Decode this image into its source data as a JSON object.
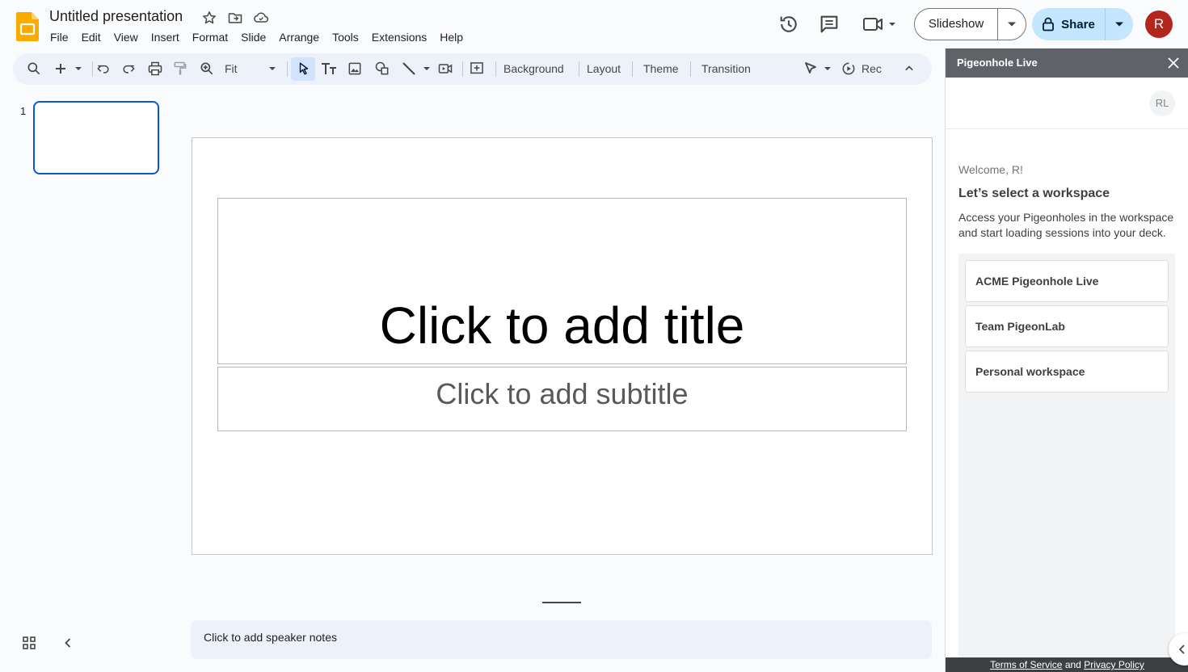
{
  "app": {
    "doc_title": "Untitled presentation",
    "logo_icon": "slides-logo-icon",
    "accent": "#0b57d0",
    "logo_color": "#f9ab00"
  },
  "menu": [
    "File",
    "Edit",
    "View",
    "Insert",
    "Format",
    "Slide",
    "Arrange",
    "Tools",
    "Extensions",
    "Help"
  ],
  "header": {
    "slideshow_label": "Slideshow",
    "share_label": "Share",
    "avatar_initial": "R",
    "avatar_color": "#b3261e"
  },
  "toolbar": {
    "zoom_label": "Fit",
    "background_label": "Background",
    "layout_label": "Layout",
    "theme_label": "Theme",
    "transition_label": "Transition",
    "rec_label": "Rec"
  },
  "filmstrip": {
    "slide_number": "1"
  },
  "slide": {
    "title_placeholder": "Click to add title",
    "subtitle_placeholder": "Click to add subtitle"
  },
  "notes": {
    "placeholder": "Click to add speaker notes"
  },
  "panel": {
    "title": "Pigeonhole Live",
    "user_badge": "RL",
    "welcome": "Welcome, R!",
    "heading": "Let’s select a workspace",
    "description": "Access your Pigeonholes in the workspace and start loading sessions into your deck.",
    "workspaces": [
      "ACME Pigeonhole Live",
      "Team PigeonLab",
      "Personal workspace"
    ],
    "footer": {
      "terms": "Terms of Service",
      "and": "and",
      "privacy": "Privacy Policy"
    }
  }
}
